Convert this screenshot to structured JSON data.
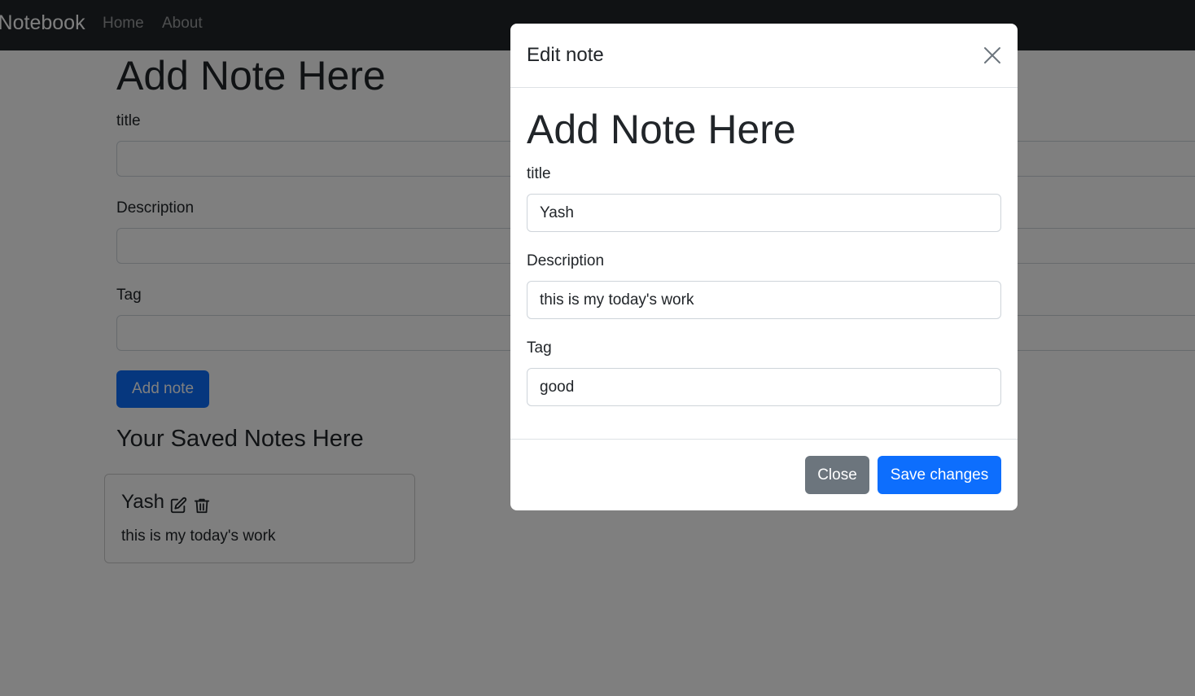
{
  "navbar": {
    "brand": "iNotebook",
    "links": [
      "Home",
      "About"
    ]
  },
  "page": {
    "heading": "Add Note Here",
    "form": {
      "title_label": "title",
      "description_label": "Description",
      "tag_label": "Tag",
      "title_value": "",
      "description_value": "",
      "tag_value": ""
    },
    "add_button": "Add note",
    "saved_heading": "Your Saved Notes Here",
    "notes": [
      {
        "title": "Yash",
        "description": "this is my today's work",
        "icons": [
          "edit-icon",
          "trash-icon"
        ]
      }
    ]
  },
  "modal": {
    "title": "Edit note",
    "heading": "Add Note Here",
    "title_label": "title",
    "title_value": "Yash",
    "description_label": "Description",
    "description_value": "this is my today's work",
    "tag_label": "Tag",
    "tag_value": "good",
    "close_button": "Close",
    "save_button": "Save changes"
  },
  "colors": {
    "navbar": "#212529",
    "primary": "#0d6efd",
    "secondary": "#6c757d",
    "backdrop": "rgba(0,0,0,0.5)"
  }
}
